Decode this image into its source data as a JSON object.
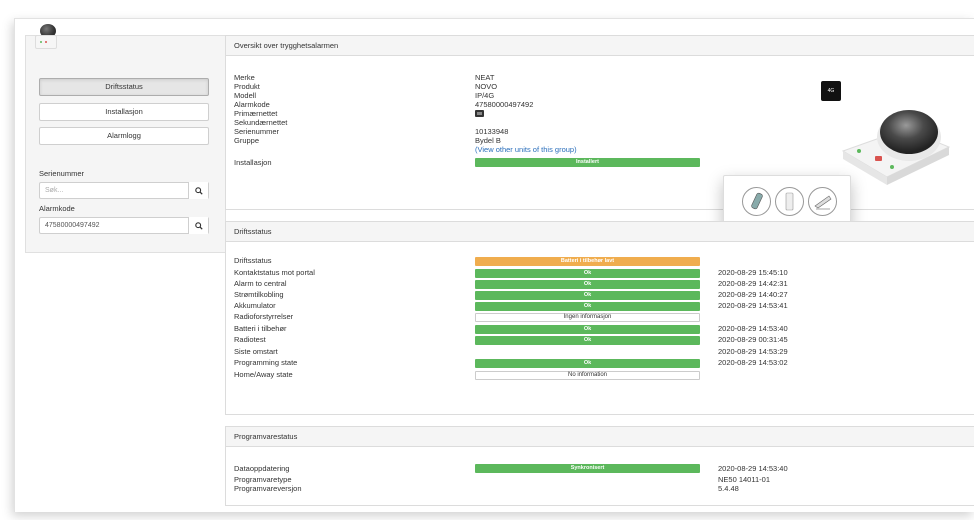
{
  "sidebar": {
    "buttons": {
      "driftsstatus": "Driftsstatus",
      "installasjon": "Installasjon",
      "alarmlogg": "Alarmlogg"
    },
    "serial_label": "Serienummer",
    "serial_placeholder": "Søk...",
    "alarm_label": "Alarmkode",
    "alarm_value": "47580000497492"
  },
  "overview": {
    "title": "Oversikt over trygghetsalarmen",
    "rows": {
      "merke": {
        "label": "Merke",
        "value": "NEAT"
      },
      "produkt": {
        "label": "Produkt",
        "value": "NOVO"
      },
      "modell": {
        "label": "Modell",
        "value": "IP/4G"
      },
      "alarmkode": {
        "label": "Alarmkode",
        "value": "47580000497492"
      },
      "primaernettet": {
        "label": "Primærnettet",
        "icon": "sim-card-icon"
      },
      "sekundaernettet": {
        "label": "Sekundærnettet",
        "value": ""
      },
      "serienummer": {
        "label": "Serienummer",
        "value": "10133948"
      },
      "gruppe": {
        "label": "Gruppe",
        "value": "Bydel B",
        "link": "(View other units of this group)"
      },
      "installasjon": {
        "label": "Installasjon",
        "status": "Installert"
      }
    },
    "badge": "4G"
  },
  "driftsstatus": {
    "title": "Driftsstatus",
    "rows": [
      {
        "label": "Driftsstatus",
        "status": "Batteri i tilbehør lavt",
        "color": "orange",
        "ts": ""
      },
      {
        "label": "Kontaktstatus mot portal",
        "status": "Ok",
        "color": "green",
        "ts": "2020-08-29 15:45:10"
      },
      {
        "label": "Alarm to central",
        "status": "Ok",
        "color": "green",
        "ts": "2020-08-29 14:42:31"
      },
      {
        "label": "Strømtilkobling",
        "status": "Ok",
        "color": "green",
        "ts": "2020-08-29 14:40:27"
      },
      {
        "label": "Akkumulator",
        "status": "Ok",
        "color": "green",
        "ts": "2020-08-29 14:53:41"
      },
      {
        "label": "Radioforstyrrelser",
        "status": "Ingen informasjon",
        "color": "white",
        "ts": ""
      },
      {
        "label": "Batteri i tilbehør",
        "status": "Ok",
        "color": "green",
        "ts": "2020-08-29 14:53:40"
      },
      {
        "label": "Radiotest",
        "status": "Ok",
        "color": "green",
        "ts": "2020-08-29 00:31:45"
      },
      {
        "label": "Siste omstart",
        "status": "",
        "color": "none",
        "ts": "2020-08-29 14:53:29"
      },
      {
        "label": "Programming state",
        "status": "Ok",
        "color": "green",
        "ts": "2020-08-29 14:53:02"
      },
      {
        "label": "Home/Away state",
        "status": "No information",
        "color": "white",
        "ts": ""
      }
    ]
  },
  "programvare": {
    "title": "Programvarestatus",
    "rows": {
      "dataoppdatering": {
        "label": "Dataoppdatering",
        "status": "Synkronisert",
        "ts": "2020-08-29 14:53:40"
      },
      "programvaretype": {
        "label": "Programvaretype",
        "value": "NE50 14011-01"
      },
      "programvareversjon": {
        "label": "Programvareversjon",
        "value": "5.4.48"
      }
    }
  },
  "colors": {
    "green": "#5cb85c",
    "orange": "#f0ad4e",
    "link": "#2a6ebb"
  }
}
